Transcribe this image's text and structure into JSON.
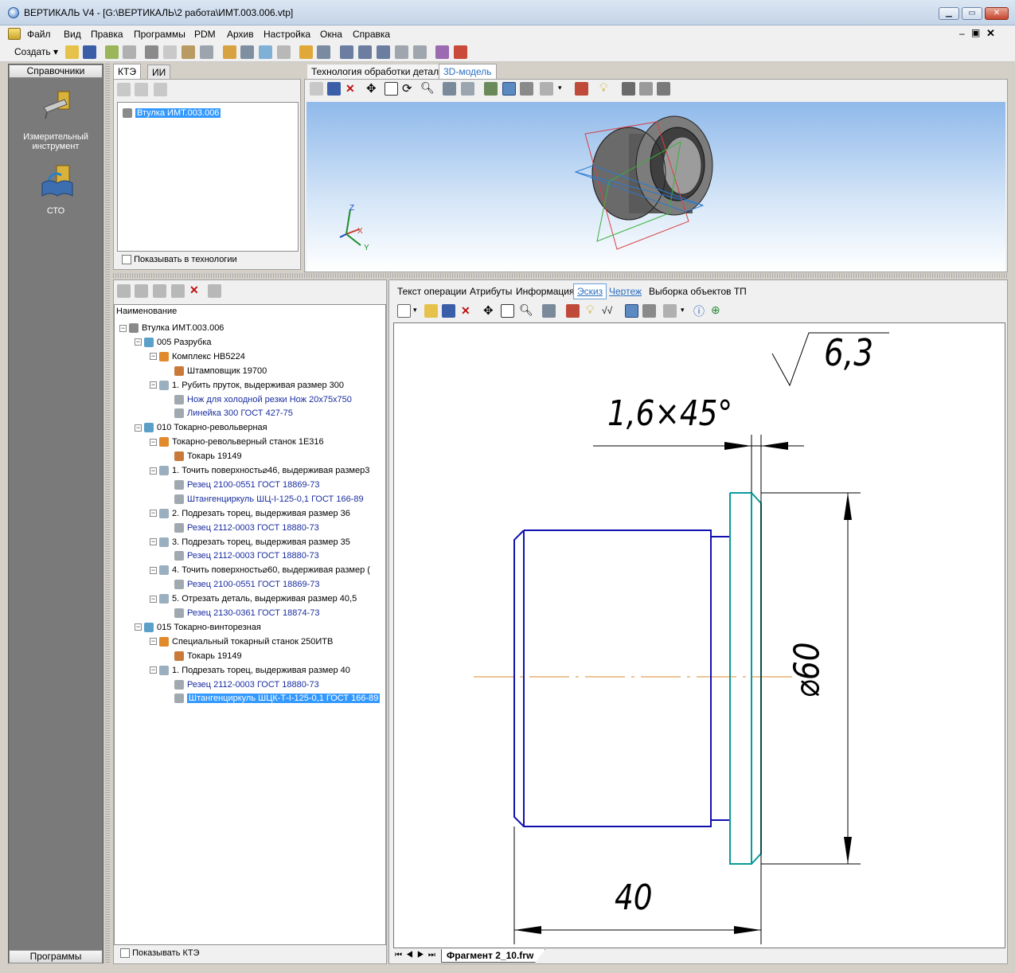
{
  "window": {
    "title": "ВЕРТИКАЛЬ V4 - [G:\\ВЕРТИКАЛЬ\\2 работа\\ИМТ.003.006.vtp]",
    "min_label": "▁",
    "max_label": "▭",
    "close_label": "✕"
  },
  "menu": [
    "Файл",
    "Вид",
    "Правка",
    "Программы",
    "PDM",
    "Архив",
    "Настройка",
    "Окна",
    "Справка"
  ],
  "toolbar": {
    "create_label": "Создать"
  },
  "sidebar": {
    "header": "Справочники",
    "footer": "Программы",
    "items": [
      {
        "label": "Измерительный инструмент",
        "icon": "caliper-icon"
      },
      {
        "label": "СТО",
        "icon": "book-icon"
      }
    ]
  },
  "kte_panel": {
    "tabs": [
      "КТЭ",
      "ИИ"
    ],
    "tree_root": "Втулка  ИМТ.003.006",
    "checkbox_label": "Показывать в технологии"
  },
  "model_panel": {
    "tabs": [
      "Технология обработки детали",
      "3D-модель"
    ],
    "axis_labels": {
      "z": "Z",
      "x": "X",
      "y": "Y"
    }
  },
  "tech_tree": {
    "header": "Наименование",
    "rows": [
      {
        "level": 0,
        "icon": "part-icon",
        "label": "Втулка  ИМТ.003.006",
        "style": "normal"
      },
      {
        "level": 1,
        "icon": "operation-A-icon",
        "label": "005  Разрубка",
        "style": "normal"
      },
      {
        "level": 2,
        "icon": "equipment-B-icon",
        "label": "Комплекс  НВ5224",
        "style": "normal"
      },
      {
        "level": 3,
        "icon": "worker-icon",
        "label": "Штамповщик  19700",
        "style": "normal"
      },
      {
        "level": 2,
        "icon": "step-O-icon",
        "label": "1.  Рубить  пруток,  выдерживая  размер  300",
        "style": "normal"
      },
      {
        "level": 3,
        "icon": "tool-T-icon",
        "label": "Нож  для  холодной  резки  Нож   20x75x750",
        "style": "blue"
      },
      {
        "level": 3,
        "icon": "tool-T-icon",
        "label": "Линейка  300  ГОСТ  427-75",
        "style": "blue"
      },
      {
        "level": 1,
        "icon": "operation-A-icon",
        "label": "010  Токарно-револьверная",
        "style": "normal"
      },
      {
        "level": 2,
        "icon": "equipment-B-icon",
        "label": "Токарно-револьверный  станок  1Е316",
        "style": "normal"
      },
      {
        "level": 3,
        "icon": "worker-icon",
        "label": "Токарь  19149",
        "style": "normal"
      },
      {
        "level": 2,
        "icon": "step-O-icon",
        "label": "1.  Точить  поверхность⌀46,  выдерживая  размер3",
        "style": "normal"
      },
      {
        "level": 3,
        "icon": "tool-T-icon",
        "label": "Резец  2100-0551  ГОСТ  18869-73",
        "style": "blue"
      },
      {
        "level": 3,
        "icon": "tool-T-icon",
        "label": "Штангенциркуль  ШЦ-І-125-0,1  ГОСТ  166-89",
        "style": "blue"
      },
      {
        "level": 2,
        "icon": "step-O-icon",
        "label": "2.  Подрезать  торец,  выдерживая  размер  36",
        "style": "normal"
      },
      {
        "level": 3,
        "icon": "tool-T-icon",
        "label": "Резец  2112-0003  ГОСТ  18880-73",
        "style": "blue"
      },
      {
        "level": 2,
        "icon": "step-O-icon",
        "label": "3.  Подрезать  торец,  выдерживая  размер  35",
        "style": "normal"
      },
      {
        "level": 3,
        "icon": "tool-T-icon",
        "label": "Резец  2112-0003  ГОСТ  18880-73",
        "style": "blue"
      },
      {
        "level": 2,
        "icon": "step-O-icon",
        "label": "4.  Точить  поверхность⌀60,  выдерживая  размер  (",
        "style": "normal"
      },
      {
        "level": 3,
        "icon": "tool-T-icon",
        "label": "Резец  2100-0551  ГОСТ  18869-73",
        "style": "blue"
      },
      {
        "level": 2,
        "icon": "step-O-icon",
        "label": "5.  Отрезать  деталь,  выдерживая  размер  40,5",
        "style": "normal"
      },
      {
        "level": 3,
        "icon": "tool-T-icon",
        "label": "Резец  2130-0361  ГОСТ  18874-73",
        "style": "blue"
      },
      {
        "level": 1,
        "icon": "operation-A-icon",
        "label": "015  Токарно-винторезная",
        "style": "normal"
      },
      {
        "level": 2,
        "icon": "equipment-B-icon",
        "label": "Специальный  токарный  станок  250ИТВ",
        "style": "normal"
      },
      {
        "level": 3,
        "icon": "worker-icon",
        "label": "Токарь  19149",
        "style": "normal"
      },
      {
        "level": 2,
        "icon": "step-O-icon",
        "label": "1.  Подрезать  торец,  выдерживая  размер  40",
        "style": "normal"
      },
      {
        "level": 3,
        "icon": "tool-T-icon",
        "label": "Резец  2112-0003  ГОСТ  18880-73",
        "style": "blue"
      },
      {
        "level": 3,
        "icon": "tool-T-icon",
        "label": "Штангенциркуль  ШЦК-Т-І-125-0,1  ГОСТ  166-89",
        "style": "selected"
      }
    ],
    "checkbox_label": "Показывать КТЭ"
  },
  "doc_panel": {
    "tabs": [
      "Текст операции",
      "Атрибуты",
      "Информация",
      "Эскиз",
      "Чертеж",
      "Выборка объектов ТП"
    ],
    "active_tab": "Эскиз",
    "sheet_tab": "Фрагмент 2_10.frw",
    "drawing": {
      "roughness": "6,3",
      "chamfer": "1,6×45°",
      "diameter": "⌀60",
      "length": "40"
    }
  },
  "colors": {
    "model_bg_top": "#9cc3ef",
    "part_line": "#1010b0",
    "flange_line": "#0a9a9a",
    "axis_line": "#d88a2c"
  }
}
